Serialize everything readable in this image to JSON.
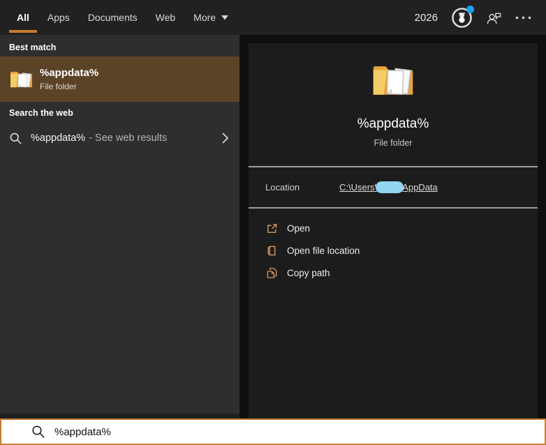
{
  "colors": {
    "accent": "#c87c33",
    "best-match-bg": "#5b4327",
    "action-icon-color": "#d39a63",
    "rewards-dot": "#1ea0f0",
    "redaction": "#93d4ef"
  },
  "icons": {
    "rewards": "medal-badge-icon",
    "feedback": "person-chat-icon",
    "more_options": "ellipsis-icon",
    "result_folder": "folder-with-documents-icon",
    "web_search": "magnifier-icon",
    "web_result_chevron": "chevron-right-icon",
    "open": "open-external-icon",
    "open_file_location": "open-folder-icon",
    "copy_path": "copy-pages-icon",
    "search_input": "magnifier-icon",
    "more_tab": "dropdown-triangle-icon"
  },
  "topbar": {
    "tabs": [
      {
        "label": "All"
      },
      {
        "label": "Apps"
      },
      {
        "label": "Documents"
      },
      {
        "label": "Web"
      },
      {
        "label": "More"
      }
    ],
    "selected_tab": "All",
    "rewards_points": "2026"
  },
  "left_panel": {
    "best_match_header": "Best match",
    "best_match": {
      "title": "%appdata%",
      "type": "File folder"
    },
    "web_section_header": "Search the web",
    "web_result": {
      "query": "%appdata%",
      "suffix": "- See web results"
    }
  },
  "detail_panel": {
    "title": "%appdata%",
    "type": "File folder",
    "location": {
      "label": "Location",
      "path_prefix": "C:\\Users\\",
      "path_suffix": "AppData"
    },
    "actions": [
      {
        "label": "Open"
      },
      {
        "label": "Open file location"
      },
      {
        "label": "Copy path"
      }
    ]
  },
  "search_bar": {
    "value": "%appdata%"
  }
}
